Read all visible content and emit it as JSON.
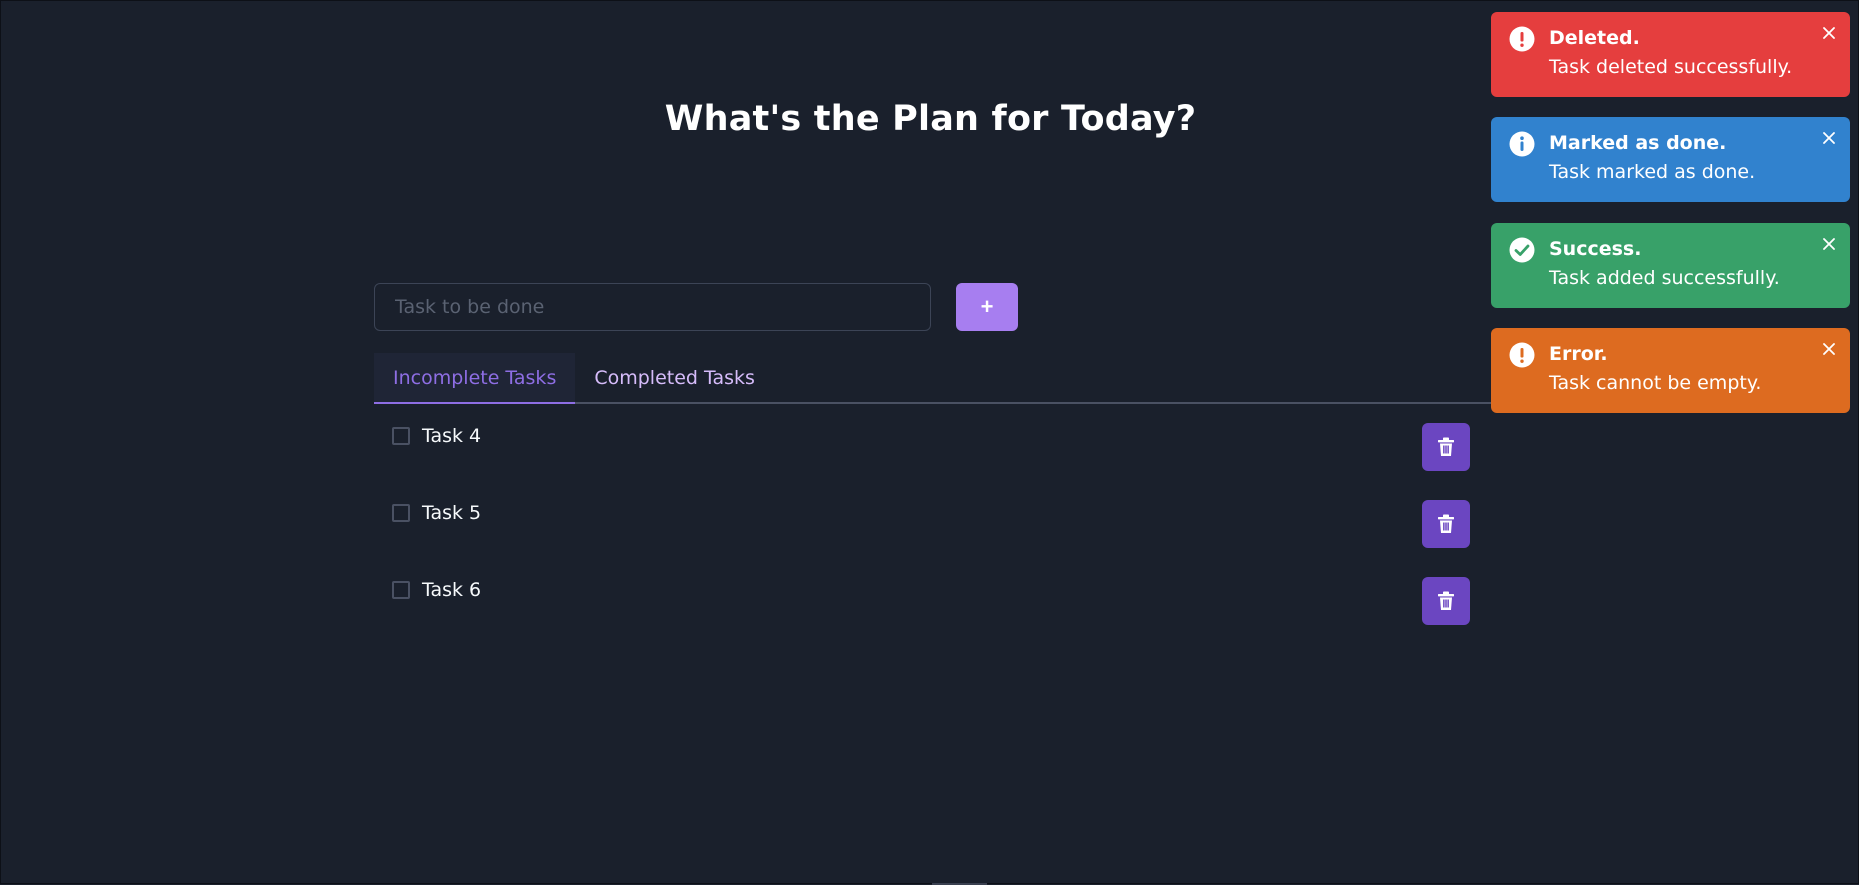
{
  "header": {
    "title": "What's the Plan for Today?"
  },
  "task_input": {
    "placeholder": "Task to be done",
    "value": ""
  },
  "add_button": {
    "label": "+"
  },
  "tabs": [
    {
      "label": "Incomplete Tasks",
      "active": true
    },
    {
      "label": "Completed Tasks",
      "active": false
    }
  ],
  "tasks": [
    {
      "label": "Task 4",
      "checked": false
    },
    {
      "label": "Task 5",
      "checked": false
    },
    {
      "label": "Task 6",
      "checked": false
    }
  ],
  "toasts": [
    {
      "title": "Deleted.",
      "description": "Task deleted successfully.",
      "status": "error",
      "color": "#e53e3e",
      "icon": "warning-circle-icon"
    },
    {
      "title": "Marked as done.",
      "description": "Task marked as done.",
      "status": "info",
      "color": "#3182ce",
      "icon": "info-circle-icon"
    },
    {
      "title": "Success.",
      "description": "Task added successfully.",
      "status": "success",
      "color": "#38a169",
      "icon": "check-circle-icon"
    },
    {
      "title": "Error.",
      "description": "Task cannot be empty.",
      "status": "warning",
      "color": "#dd6b20",
      "icon": "warning-circle-icon"
    }
  ],
  "colors": {
    "background": "#1a202c",
    "accent": "#8e6ee4",
    "add_button": "#a77ef0",
    "delete_button": "#6b46c1"
  }
}
